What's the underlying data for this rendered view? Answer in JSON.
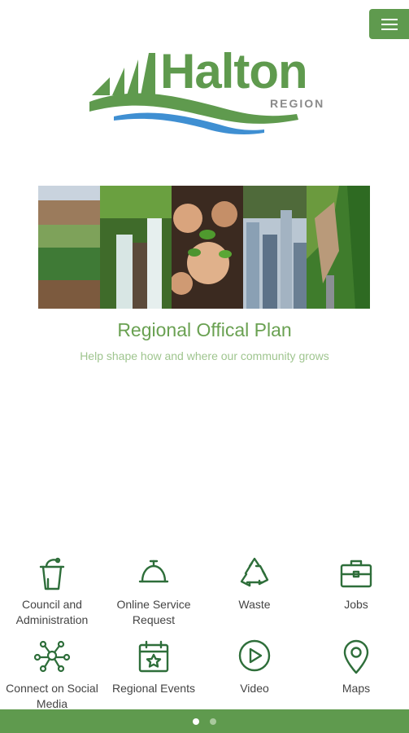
{
  "header": {
    "menu_icon": "hamburger-icon",
    "logo": {
      "name": "Halton",
      "sub": "REGION"
    }
  },
  "banner": {
    "title": "Regional Offical Plan",
    "subtitle": "Help shape how and where our community grows"
  },
  "services": [
    {
      "label": "Council and Administration",
      "icon": "podium-icon"
    },
    {
      "label": "Online Service Request",
      "icon": "service-bell-icon"
    },
    {
      "label": "Waste",
      "icon": "recycle-icon"
    },
    {
      "label": "Jobs",
      "icon": "briefcase-icon"
    },
    {
      "label": "Connect on Social Media",
      "icon": "network-icon"
    },
    {
      "label": "Regional Events",
      "icon": "calendar-star-icon"
    },
    {
      "label": "Video",
      "icon": "play-circle-icon"
    },
    {
      "label": "Maps",
      "icon": "map-pin-icon"
    }
  ],
  "pager": {
    "pages": 2,
    "current": 1
  },
  "colors": {
    "brand": "#5f9a4e",
    "banner_title": "#6aa152",
    "banner_subtitle": "#9fc58f"
  }
}
